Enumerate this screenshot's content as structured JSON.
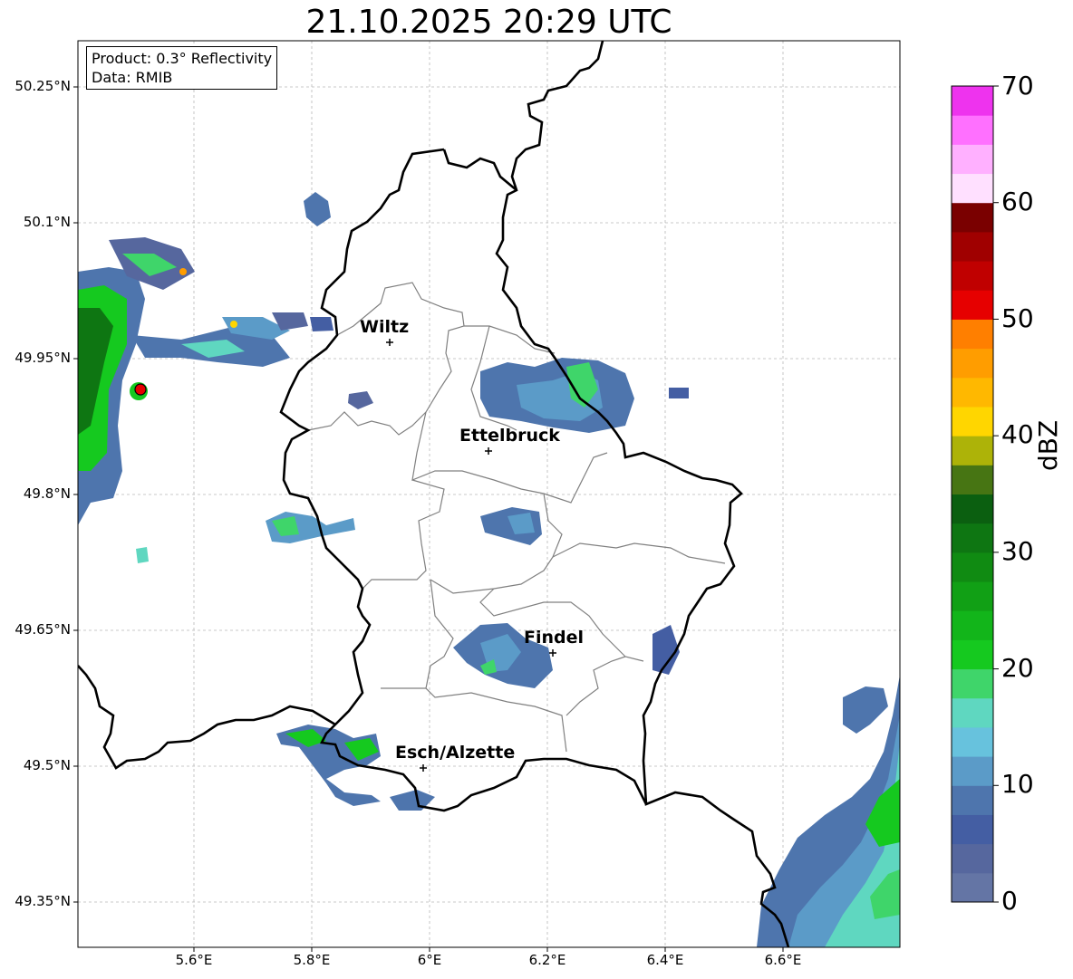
{
  "title": "21.10.2025 20:29 UTC",
  "info": {
    "product": "Product: 0.3° Reflectivity",
    "data": "Data: RMIB"
  },
  "lat_labels": [
    "50.25°N",
    "50.1°N",
    "49.95°N",
    "49.8°N",
    "49.65°N",
    "49.5°N",
    "49.35°N"
  ],
  "lon_labels": [
    "5.6°E",
    "5.8°E",
    "6°E",
    "6.2°E",
    "6.4°E",
    "6.6°E"
  ],
  "cities": [
    {
      "name": "Wiltz",
      "lon": 5.93,
      "lat": 49.966
    },
    {
      "name": "Ettelbruck",
      "lon": 6.1,
      "lat": 49.848
    },
    {
      "name": "Findel",
      "lon": 6.21,
      "lat": 49.627
    },
    {
      "name": "Esch/Alzette",
      "lon": 5.99,
      "lat": 49.497
    }
  ],
  "radar_site": {
    "lon": 5.505,
    "lat": 49.914
  },
  "colorbar": {
    "label": "dBZ",
    "ticks": [
      "0",
      "10",
      "20",
      "30",
      "40",
      "50",
      "60",
      "70"
    ],
    "colors": [
      "#6475a5",
      "#56679e",
      "#445ea3",
      "#4e75ad",
      "#5b9bc8",
      "#67c2dd",
      "#5fd7c0",
      "#3fd56a",
      "#15c91f",
      "#12b51a",
      "#11a015",
      "#108b12",
      "#0e7612",
      "#0b5f10",
      "#477513",
      "#adb308",
      "#ffd600",
      "#ffb800",
      "#ff9d00",
      "#ff7f00",
      "#e60000",
      "#c00000",
      "#a00000",
      "#7a0000",
      "#ffe0ff",
      "#ffb0ff",
      "#ff70ff",
      "#ee33ee"
    ]
  },
  "colors": {
    "border": "#000000",
    "cantons": "#808080",
    "grid": "#b8b8b8"
  }
}
